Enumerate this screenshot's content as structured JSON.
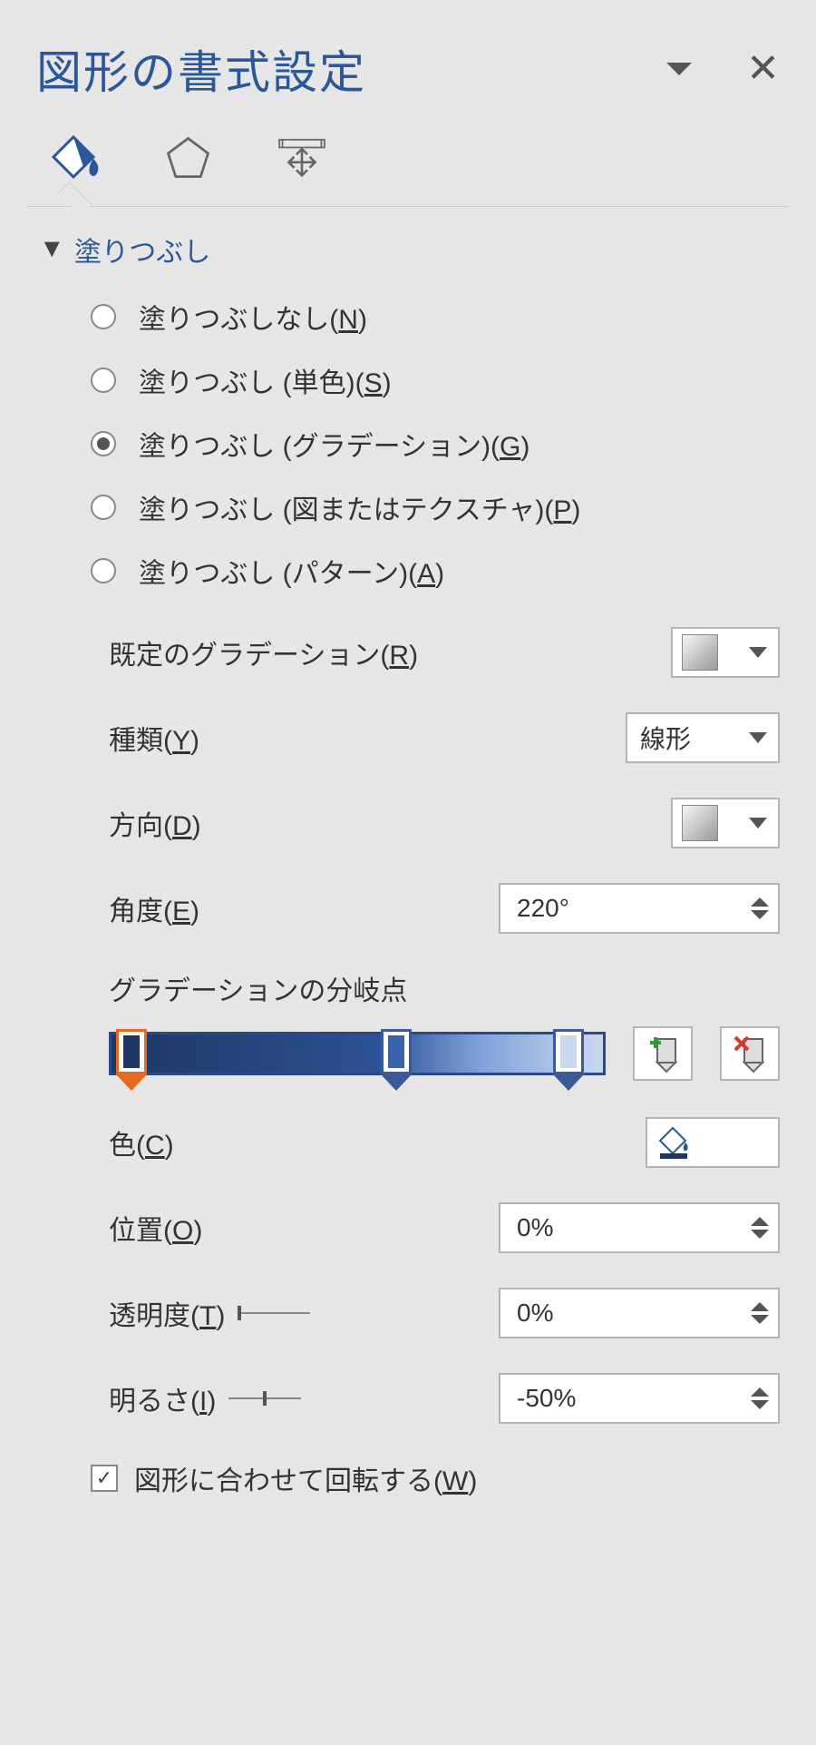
{
  "title": "図形の書式設定",
  "section": {
    "fill_title": "塗りつぶし"
  },
  "radios": {
    "none": "塗りつぶしなし(N)",
    "solid": "塗りつぶし (単色)(S)",
    "gradient": "塗りつぶし (グラデーション)(G)",
    "picture": "塗りつぶし (図またはテクスチャ)(P)",
    "pattern": "塗りつぶし (パターン)(A)",
    "selected": "gradient"
  },
  "controls": {
    "preset_label": "既定のグラデーション(R)",
    "type_label": "種類(Y)",
    "type_value": "線形",
    "direction_label": "方向(D)",
    "angle_label": "角度(E)",
    "angle_value": "220°",
    "stops_label": "グラデーションの分岐点",
    "color_label": "色(C)",
    "position_label": "位置(O)",
    "position_value": "0%",
    "transparency_label": "透明度(T)",
    "transparency_value": "0%",
    "brightness_label": "明るさ(I)",
    "brightness_value": "-50%",
    "rotate_label": "図形に合わせて回転する(W)",
    "rotate_checked": true
  },
  "gradient_stops": [
    {
      "pos": 4,
      "color": "#1e3762",
      "selected": true
    },
    {
      "pos": 58,
      "color": "#3b62a8",
      "selected": false
    },
    {
      "pos": 93,
      "color": "#c9d8ef",
      "selected": false
    }
  ],
  "colors": {
    "selected_stop_color": "#1e3762",
    "accent": "#2a579a"
  }
}
